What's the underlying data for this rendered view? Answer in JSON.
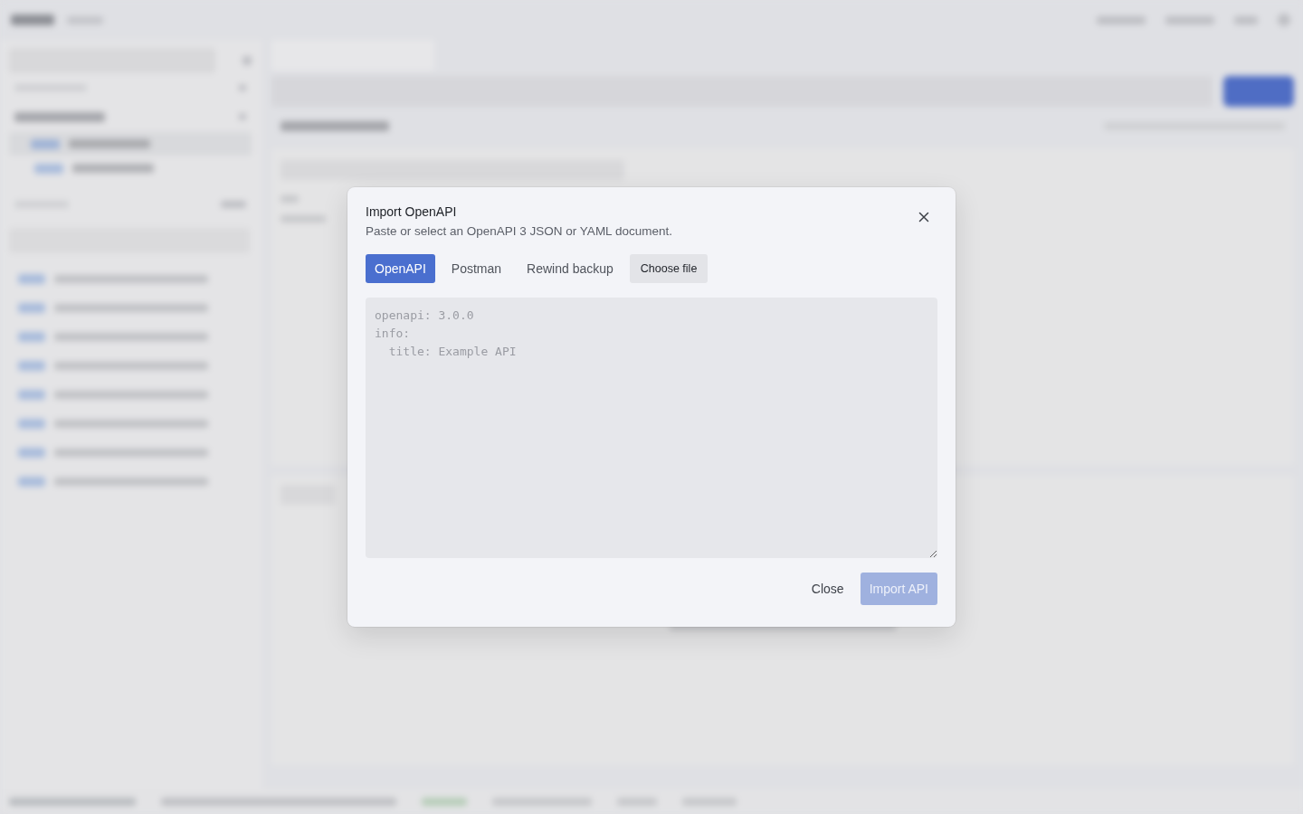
{
  "dialog": {
    "title": "Import OpenAPI",
    "description": "Paste or select an OpenAPI 3 JSON or YAML document.",
    "tabs": [
      {
        "label": "OpenAPI",
        "selected": true
      },
      {
        "label": "Postman",
        "selected": false
      },
      {
        "label": "Rewind backup",
        "selected": false
      }
    ],
    "file_button": {
      "label": "Choose file"
    },
    "editor": {
      "placeholder": "openapi: 3.0.0\ninfo:\n  title: Example API"
    },
    "buttons": [
      {
        "label": "Close",
        "kind": "secondary",
        "disabled": false
      },
      {
        "label": "Import API",
        "kind": "primary",
        "disabled": true
      }
    ]
  }
}
